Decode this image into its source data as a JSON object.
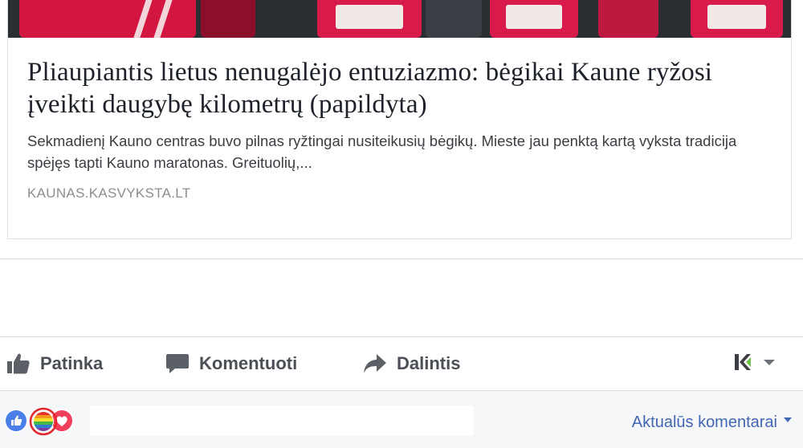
{
  "link_preview": {
    "headline": "Pliaupiantis lietus nenugalėjo entuziazmo: bėgikai Kaune ryžosi įveikti daugybę kilometrų (papildyta)",
    "description": "Sekmadienį Kauno centras buvo pilnas ryžtingai nusiteikusių bėgikų. Mieste jau penktą kartą vyksta tradicija spėjęs tapti Kauno maratonas. Greituolių,...",
    "domain": "KAUNAS.KASVYKSTA.LT"
  },
  "actions": {
    "like_label": "Patinka",
    "comment_label": "Komentuoti",
    "share_label": "Dalintis",
    "like_icon": "thumbs-up-icon",
    "comment_icon": "speech-bubble-icon",
    "share_icon": "share-arrow-icon"
  },
  "reactions": {
    "items": [
      "like-reaction-icon",
      "pride-rainbow-reaction-icon",
      "love-reaction-icon"
    ],
    "colors": {
      "like": "#4a7ee8",
      "love": "#ef3f5a",
      "highlight_ring": "#e3262e"
    }
  },
  "comments": {
    "sort_label": "Aktualūs komentarai"
  }
}
